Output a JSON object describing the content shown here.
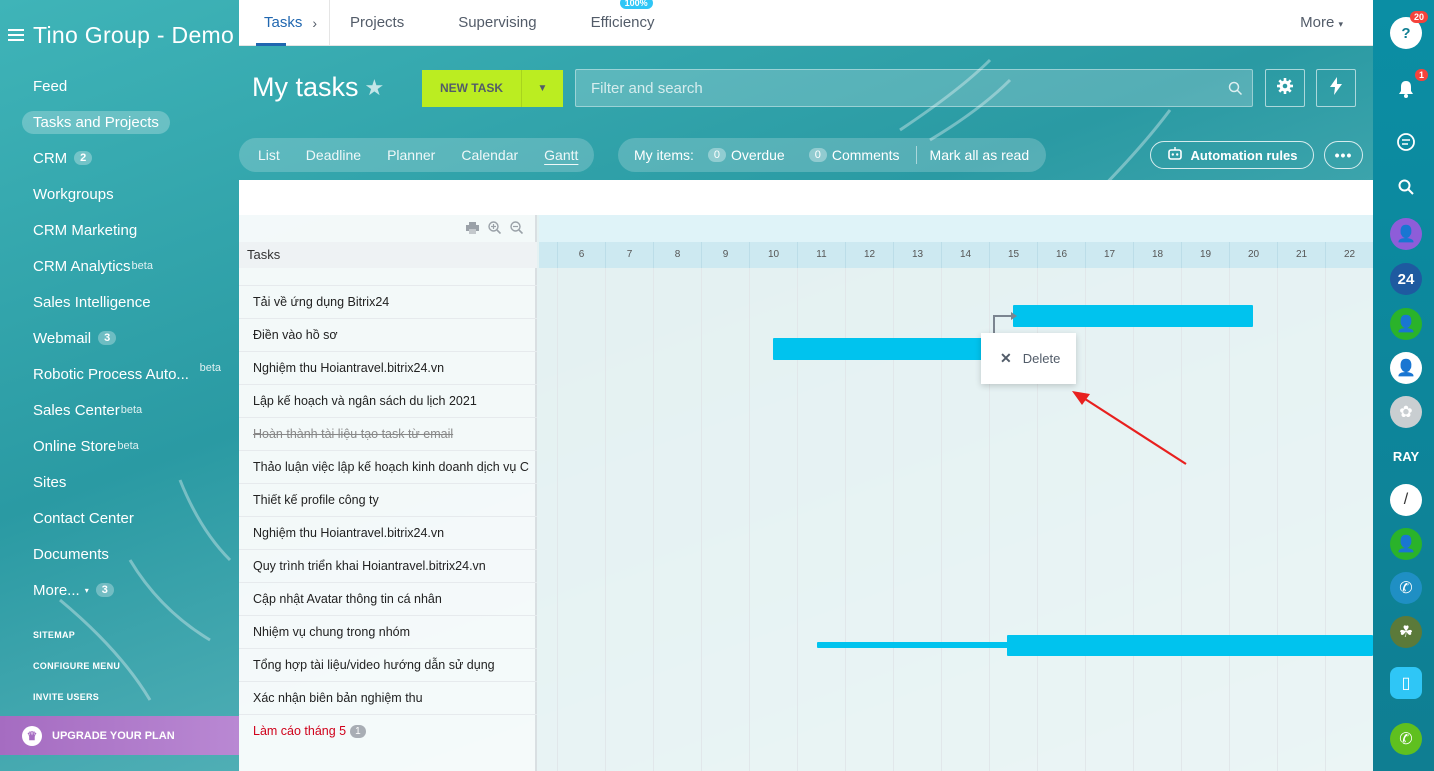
{
  "brand": {
    "title": "Tino Group - Demo"
  },
  "sidebar": {
    "items": [
      {
        "label": "Feed",
        "count": "",
        "sup": ""
      },
      {
        "label": "Tasks and Projects",
        "count": "",
        "sup": ""
      },
      {
        "label": "CRM",
        "count": "2",
        "sup": ""
      },
      {
        "label": "Workgroups",
        "count": "",
        "sup": ""
      },
      {
        "label": "CRM Marketing",
        "count": "",
        "sup": ""
      },
      {
        "label": "CRM Analytics",
        "count": "",
        "sup": "beta"
      },
      {
        "label": "Sales Intelligence",
        "count": "",
        "sup": ""
      },
      {
        "label": "Webmail",
        "count": "3",
        "sup": ""
      },
      {
        "label": "Robotic Process Auto...",
        "count": "",
        "sup": "beta"
      },
      {
        "label": "Sales Center",
        "count": "",
        "sup": "beta"
      },
      {
        "label": "Online Store",
        "count": "",
        "sup": "beta"
      },
      {
        "label": "Sites",
        "count": "",
        "sup": ""
      },
      {
        "label": "Contact Center",
        "count": "",
        "sup": ""
      },
      {
        "label": "Documents",
        "count": "",
        "sup": ""
      },
      {
        "label": "More...",
        "count": "3",
        "sup": ""
      }
    ],
    "links": [
      "SITEMAP",
      "CONFIGURE MENU",
      "INVITE USERS"
    ],
    "upgrade_label": "UPGRADE YOUR PLAN"
  },
  "tabs": {
    "items": [
      "Tasks",
      "Projects",
      "Supervising",
      "Efficiency"
    ],
    "efficiency_badge": "100%",
    "more": "More"
  },
  "header": {
    "title": "My tasks",
    "new_task": "NEW TASK",
    "search_placeholder": "Filter and search"
  },
  "views": {
    "items": [
      "List",
      "Deadline",
      "Planner",
      "Calendar",
      "Gantt"
    ],
    "active": "Gantt"
  },
  "my_items": {
    "label": "My items:",
    "overdue_count": "0",
    "overdue_label": "Overdue",
    "comments_count": "0",
    "comments_label": "Comments",
    "mark_read": "Mark all as read"
  },
  "automation_label": "Automation rules",
  "gantt": {
    "tasks_header": "Tasks",
    "days": [
      "6",
      "7",
      "8",
      "9",
      "10",
      "11",
      "12",
      "13",
      "14",
      "15",
      "16",
      "17",
      "18",
      "19",
      "20",
      "21",
      "22"
    ],
    "tasks": [
      {
        "name": "Tải về ứng dụng Bitrix24",
        "state": "normal",
        "count": ""
      },
      {
        "name": "Điền vào hồ sơ",
        "state": "normal",
        "count": ""
      },
      {
        "name": "Nghiệm thu Hoiantravel.bitrix24.vn",
        "state": "normal",
        "count": ""
      },
      {
        "name": "Lập kế hoạch và ngân sách du lịch 2021",
        "state": "normal",
        "count": ""
      },
      {
        "name": "Hoàn thành tài liệu tạo task từ email",
        "state": "done",
        "count": ""
      },
      {
        "name": "Thảo luận việc lập kế hoạch kinh doanh dịch vụ C",
        "state": "normal",
        "count": ""
      },
      {
        "name": "Thiết kế profile công ty",
        "state": "normal",
        "count": ""
      },
      {
        "name": "Nghiệm thu Hoiantravel.bitrix24.vn",
        "state": "normal",
        "count": ""
      },
      {
        "name": "Quy trình triển khai Hoiantravel.bitrix24.vn",
        "state": "normal",
        "count": ""
      },
      {
        "name": "Cập nhật Avatar thông tin cá nhân",
        "state": "normal",
        "count": ""
      },
      {
        "name": "Nhiệm vụ chung trong nhóm",
        "state": "normal",
        "count": ""
      },
      {
        "name": "Tổng hợp tài liệu/video hướng dẫn sử dụng",
        "state": "normal",
        "count": ""
      },
      {
        "name": "Xác nhận biên bản nghiệm thu",
        "state": "normal",
        "count": ""
      },
      {
        "name": "Làm cáo tháng 5",
        "state": "overdue",
        "count": "1"
      }
    ],
    "popup_label": "Delete"
  },
  "rightbar": {
    "help_badge": "20",
    "notify_badge": "1",
    "app_label": "24",
    "ray_label": "RAY"
  }
}
